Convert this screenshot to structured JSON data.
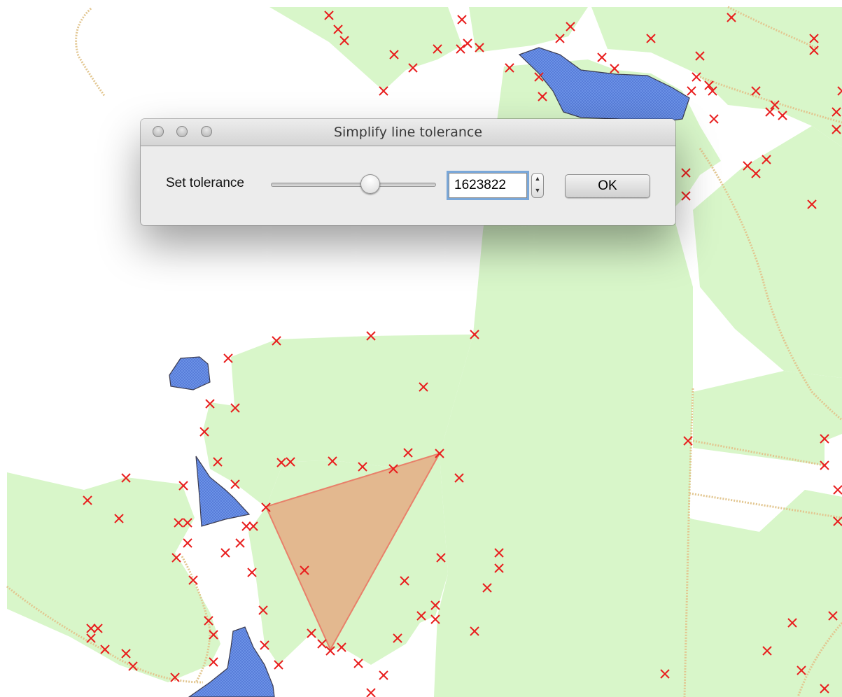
{
  "dialog": {
    "title": "Simplify line tolerance",
    "tolerance_label": "Set tolerance",
    "tolerance_value": "1623822",
    "slider_position": 0.6,
    "ok_label": "OK",
    "stepper_up": "▲",
    "stepper_down": "▼"
  },
  "map": {
    "colors": {
      "vegetation": "#d8f6c9",
      "water": "#6e95e8",
      "water_edge": "#3c3c50",
      "selected_polygon": "#e4b48c",
      "selected_edge": "#e8806a",
      "vertex_marker": "#e81e1e",
      "track": "#e2c690",
      "background": "#ffffff"
    }
  }
}
